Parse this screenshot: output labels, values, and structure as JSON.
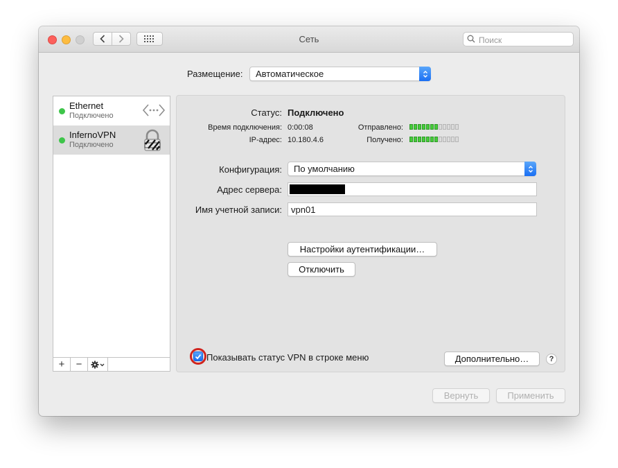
{
  "window": {
    "title": "Сеть"
  },
  "search": {
    "placeholder": "Поиск"
  },
  "location": {
    "label": "Размещение:",
    "value": "Автоматическое"
  },
  "services": [
    {
      "name": "Ethernet",
      "status": "Подключено",
      "status_color": "#3ec54a",
      "icon": "ethernet-arrows-icon"
    },
    {
      "name": "InfernoVPN",
      "status": "Подключено",
      "status_color": "#3ec54a",
      "icon": "vpn-lock-icon"
    }
  ],
  "sidebar_buttons": {
    "add": "+",
    "remove": "−"
  },
  "details": {
    "status_label": "Статус:",
    "status_value": "Подключено",
    "connect_time_label": "Время подключения:",
    "connect_time_value": "0:00:08",
    "ip_label": "IP-адрес:",
    "ip_value": "10.180.4.6",
    "sent_label": "Отправлено:",
    "sent_level": 7,
    "received_label": "Получено:",
    "received_level": 7,
    "meter_segments": 12
  },
  "config": {
    "configuration_label": "Конфигурация:",
    "configuration_value": "По умолчанию",
    "server_label": "Адрес сервера:",
    "account_label": "Имя учетной записи:",
    "account_value": "vpn01"
  },
  "buttons": {
    "auth_settings": "Настройки аутентификации…",
    "disconnect": "Отключить",
    "advanced": "Дополнительно…",
    "help": "?",
    "revert": "Вернуть",
    "apply": "Применить"
  },
  "show_vpn_status": {
    "label": "Показывать статус VPN в строке меню",
    "checked": true
  },
  "colors": {
    "accent": "#1a6ff3",
    "connected": "#3ec54a",
    "highlight_ring": "#d0241e",
    "meter_on": "#47cc3a"
  }
}
